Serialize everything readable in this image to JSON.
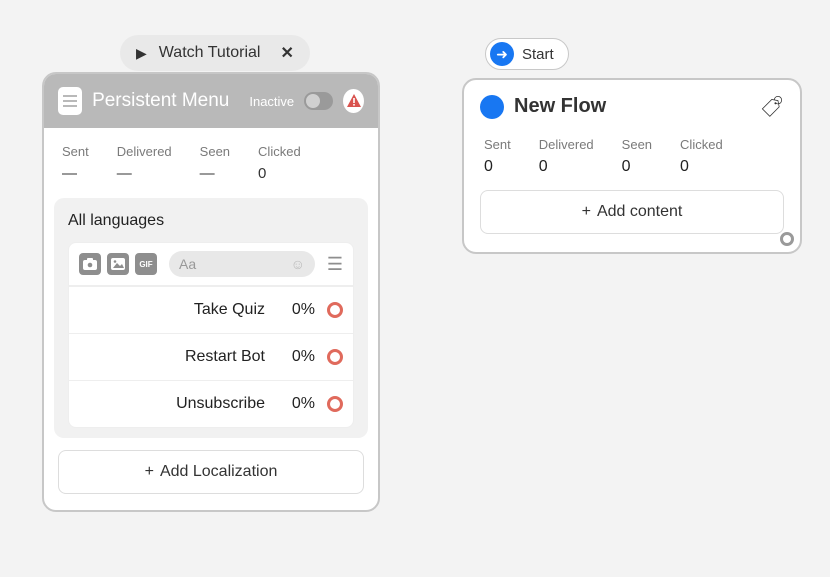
{
  "tutorial": {
    "label": "Watch Tutorial"
  },
  "persistent_menu": {
    "title": "Persistent Menu",
    "status_label": "Inactive",
    "stats": {
      "sent": {
        "label": "Sent",
        "value": "—"
      },
      "delivered": {
        "label": "Delivered",
        "value": "—"
      },
      "seen": {
        "label": "Seen",
        "value": "—"
      },
      "clicked": {
        "label": "Clicked",
        "value": "0"
      }
    },
    "lang_title": "All languages",
    "composer_placeholder": "Aa",
    "gif_label": "GIF",
    "items": [
      {
        "label": "Take Quiz",
        "pct": "0%"
      },
      {
        "label": "Restart Bot",
        "pct": "0%"
      },
      {
        "label": "Unsubscribe",
        "pct": "0%"
      }
    ],
    "add_localization_label": "Add Localization"
  },
  "start": {
    "label": "Start"
  },
  "new_flow": {
    "title": "New Flow",
    "stats": {
      "sent": {
        "label": "Sent",
        "value": "0"
      },
      "delivered": {
        "label": "Delivered",
        "value": "0"
      },
      "seen": {
        "label": "Seen",
        "value": "0"
      },
      "clicked": {
        "label": "Clicked",
        "value": "0"
      }
    },
    "add_content_label": "Add content"
  }
}
